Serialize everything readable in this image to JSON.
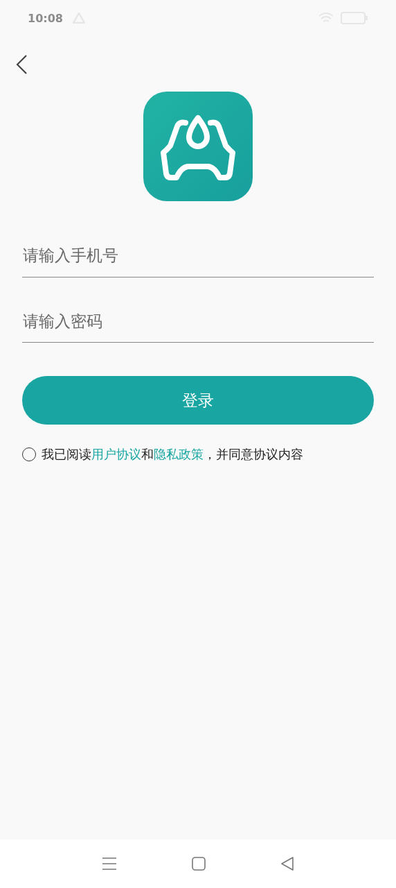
{
  "status_bar": {
    "time": "10:08"
  },
  "phone_field": {
    "placeholder": "请输入手机号"
  },
  "password_field": {
    "placeholder": "请输入密码"
  },
  "login_button": {
    "label": "登录"
  },
  "agreement": {
    "checked": false,
    "prefix": "我已阅读",
    "user_agreement_link": "用户协议",
    "joiner": "和",
    "privacy_link": "隐私政策",
    "suffix": "，并同意协议内容"
  }
}
